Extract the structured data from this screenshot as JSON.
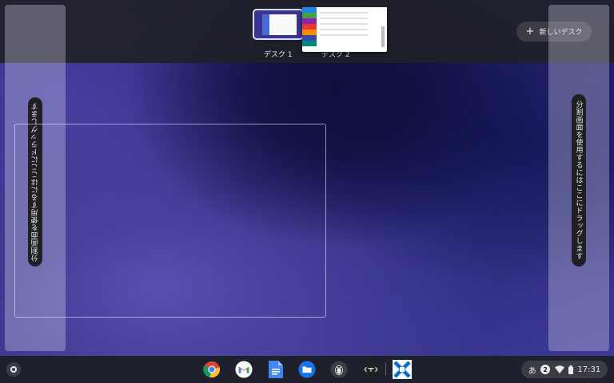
{
  "desks": {
    "items": [
      {
        "label": "デスク 1"
      },
      {
        "label": "デスク 2"
      }
    ],
    "new_desk_label": "新しいデスク"
  },
  "split_view": {
    "left_hint": "分割画面を使用するにはここにドラッグします",
    "right_hint": "分割画面を使用するにはここにドラッグします"
  },
  "shelf": {
    "apps": [
      "chrome-icon",
      "gmail-icon",
      "docs-icon",
      "files-icon",
      "linux-penguin-icon",
      "text-editor-icon",
      "app-x-icon"
    ],
    "ime": "あ",
    "notification_count": "2",
    "time": "17:31"
  },
  "colors": {
    "desk_bar": "#202128",
    "selected_outline": "#d8dcff",
    "shelf": "#1e1f28"
  }
}
